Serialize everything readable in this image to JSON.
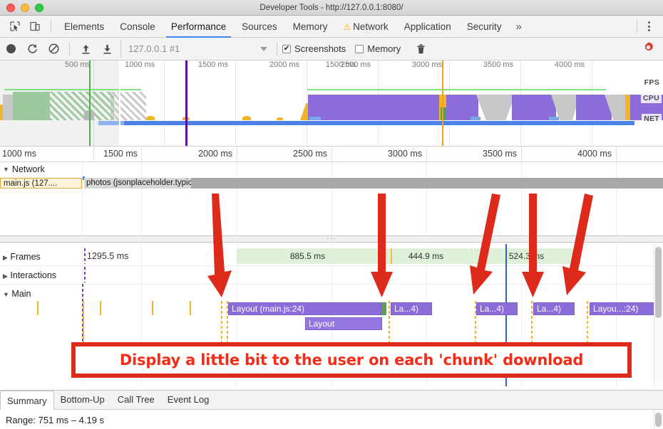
{
  "window": {
    "title": "Developer Tools - http://127.0.0.1:8080/",
    "buttons": {
      "close": "close",
      "minimize": "minimize",
      "zoom": "zoom"
    }
  },
  "tabbar": {
    "inspect_icon": "inspect-element-icon",
    "device_icon": "device-toolbar-icon",
    "tabs": [
      {
        "label": "Elements",
        "active": false
      },
      {
        "label": "Console",
        "active": false
      },
      {
        "label": "Performance",
        "active": true
      },
      {
        "label": "Sources",
        "active": false
      },
      {
        "label": "Memory",
        "active": false
      },
      {
        "label": "Network",
        "active": false,
        "warning": "⚠"
      },
      {
        "label": "Application",
        "active": false
      },
      {
        "label": "Security",
        "active": false
      }
    ],
    "more_label": "»",
    "menu_icon": "kebab-menu-icon"
  },
  "toolbar": {
    "record_icon": "record-icon",
    "reload_icon": "reload-and-record-icon",
    "clear_icon": "clear-recording-icon",
    "upload_icon": "load-profile-icon",
    "download_icon": "save-profile-icon",
    "profile_name": "127.0.0.1 #1",
    "dropdown_icon": "chevron-down-icon",
    "screenshots_label": "Screenshots",
    "screenshots_checked": true,
    "memory_label": "Memory",
    "memory_checked": false,
    "trash_icon": "collect-garbage-icon",
    "settings_icon": "gear-icon"
  },
  "overview": {
    "ruler_ticks": [
      "500 ms",
      "1000 ms",
      "1500 ms",
      "2000 ms",
      "2500 ms",
      "3000 ms",
      "3500 ms",
      "4000 ms"
    ],
    "row_labels": {
      "fps": "FPS",
      "cpu": "CPU",
      "net": "NET"
    }
  },
  "timeline_ruler": {
    "ticks": [
      "1000 ms",
      "1500 ms",
      "2000 ms",
      "2500 ms",
      "3000 ms",
      "3500 ms",
      "4000 ms"
    ]
  },
  "network_section": {
    "title": "Network",
    "expander": "▼",
    "requests": [
      {
        "label": "main.js (127....",
        "kind": "script"
      },
      {
        "label": "photos (jsonplaceholder.typicode.com)",
        "kind": "xhr"
      }
    ]
  },
  "divider": {
    "ellipsis": "···"
  },
  "tracks": [
    {
      "label": "Frames",
      "expander": "▶"
    },
    {
      "label": "Interactions",
      "expander": "▶"
    },
    {
      "label": "Main",
      "expander": "▼"
    }
  ],
  "frames": [
    {
      "duration": "1295.5 ms",
      "shaded": false
    },
    {
      "duration": "885.5 ms",
      "shaded": true
    },
    {
      "duration": "444.9 ms",
      "shaded": true
    },
    {
      "duration": "524.3 ms",
      "shaded": true
    }
  ],
  "main_events": [
    {
      "label": "Layout (main.js:24)",
      "row": 0
    },
    {
      "label": "La...4)",
      "row": 0
    },
    {
      "label": "La...4)",
      "row": 0
    },
    {
      "label": "La...4)",
      "row": 0
    },
    {
      "label": "Layou...:24)",
      "row": 0
    },
    {
      "label": "Layout",
      "row": 1
    }
  ],
  "annotation": {
    "text": "Display a little bit to the user on each 'chunk' download",
    "border_color": "#dd2a1b",
    "text_color": "#f42b16",
    "arrow_color": "#dd2a1b",
    "arrow_count": 5
  },
  "bottom_tabs": [
    {
      "label": "Summary",
      "active": true
    },
    {
      "label": "Bottom-Up",
      "active": false
    },
    {
      "label": "Call Tree",
      "active": false
    },
    {
      "label": "Event Log",
      "active": false
    }
  ],
  "summary": {
    "range": "Range: 751 ms – 4.19 s"
  },
  "colors": {
    "accent": "#4285f4",
    "record": "#4d4d4d",
    "gear": "#d23f31",
    "cpu_scripting": "#8b6cd8",
    "cpu_idle": "#c8c8c8",
    "cpu_painting": "#5aa04f",
    "cpu_loading": "#f0b429",
    "fps_green": "#7ee07e",
    "net_blue": "#4d82e8",
    "frame_green": "#dff0d8",
    "annotation_red": "#dd2a1b"
  }
}
